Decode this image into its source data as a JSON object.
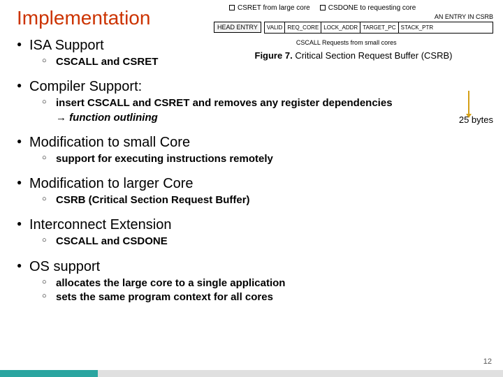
{
  "title": "Implementation",
  "sections": [
    {
      "heading": "ISA Support",
      "items": [
        "CSCALL and CSRET"
      ]
    },
    {
      "heading": "Compiler Support:",
      "items": [
        "insert CSCALL and CSRET and removes any register dependencies → function outlining"
      ],
      "italic_tail": "function outlining"
    },
    {
      "heading": "Modification to small Core",
      "items": [
        "support for executing instructions remotely"
      ]
    },
    {
      "heading": "Modification to larger Core",
      "items": [
        "CSRB  (Critical Section Request Buffer)"
      ]
    },
    {
      "heading": "Interconnect Extension",
      "items": [
        "CSCALL and CSDONE"
      ]
    },
    {
      "heading": "OS support",
      "items": [
        "allocates the large core to a single application",
        " sets the same program context for all cores"
      ]
    }
  ],
  "figure": {
    "top_labels": [
      "CSRET from large core",
      "CSDONE to requesting core"
    ],
    "head_entry": "HEAD ENTRY",
    "entry_label": "AN ENTRY IN CSRB",
    "fields": [
      "VALID",
      "REQ_CORE",
      "LOCK_ADDR",
      "TARGET_PC",
      "STACK_PTR"
    ],
    "bottom_label": "CSCALL Requests from small cores",
    "caption_bold": "Figure 7.",
    "caption_rest": "Critical Section Request Buffer (CSRB)"
  },
  "side_note": "25 bytes",
  "page_number": "12"
}
